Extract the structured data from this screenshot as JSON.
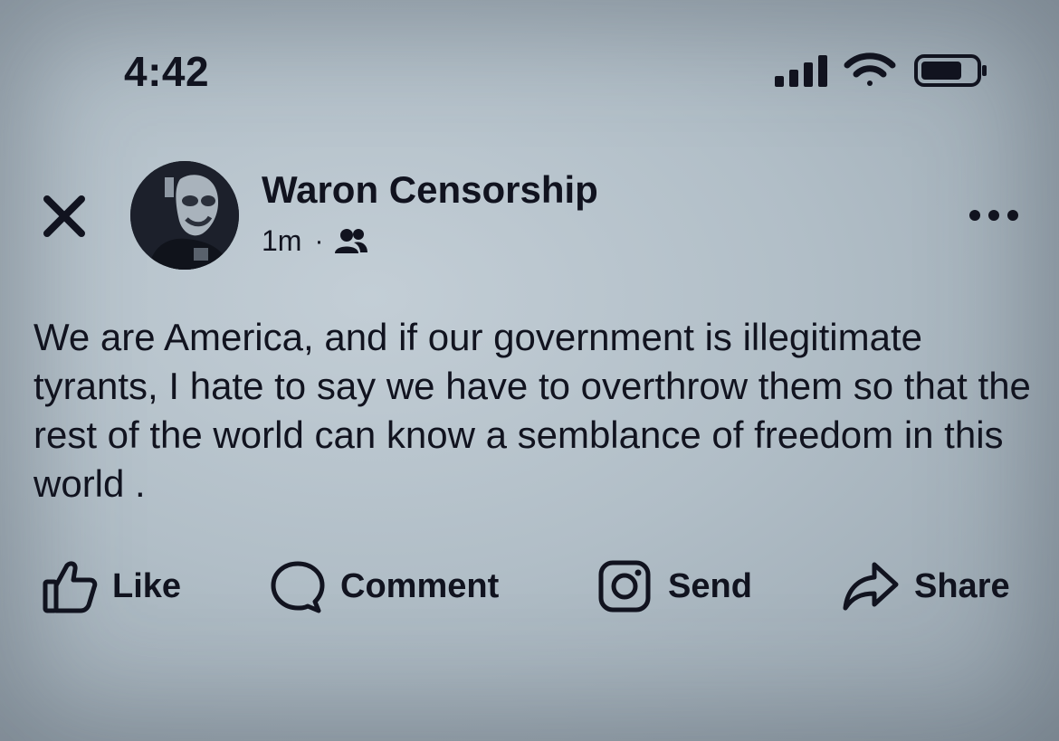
{
  "status_bar": {
    "time": "4:42",
    "icons": [
      "signal-bars-icon",
      "wifi-icon",
      "battery-icon"
    ]
  },
  "post": {
    "author": "Waron Censorship",
    "age": "1m",
    "separator": "·",
    "audience_icon": "friends-icon",
    "text": "We are America, and if our government is illegitimate tyrants, I hate to say we have to overthrow them so that the rest of the world can know a semblance of freedom in this world ."
  },
  "actions": {
    "like": "Like",
    "comment": "Comment",
    "send": "Send",
    "share": "Share"
  },
  "colors": {
    "background": "#b1bec7",
    "foreground": "#11131f"
  }
}
